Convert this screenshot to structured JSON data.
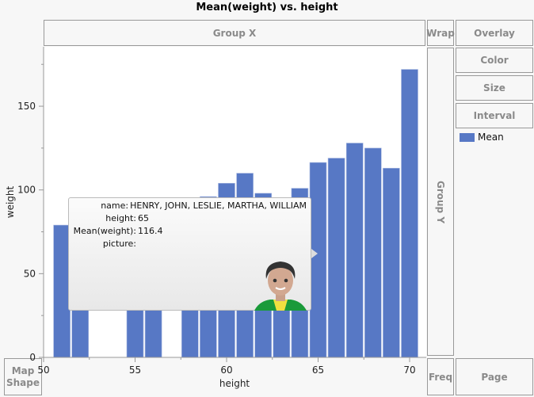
{
  "title": "Mean(weight) vs. height",
  "zones": {
    "group_x": "Group X",
    "group_y": "Group Y",
    "wrap": "Wrap",
    "overlay": "Overlay",
    "color": "Color",
    "size": "Size",
    "interval": "Interval",
    "freq": "Freq",
    "page": "Page",
    "map_shape": "Map Shape"
  },
  "legend": {
    "label": "Mean",
    "color": "#5778c5"
  },
  "tooltip": {
    "rows": [
      {
        "label": "name:",
        "value": "HENRY, JOHN, LESLIE, MARTHA, WILLIAM"
      },
      {
        "label": "height:",
        "value": "65"
      },
      {
        "label": "Mean(weight):",
        "value": "116.4"
      },
      {
        "label": "picture:",
        "value": ""
      }
    ]
  },
  "chart_data": {
    "type": "bar",
    "title": "Mean(weight) vs. height",
    "xlabel": "height",
    "ylabel": "weight",
    "xlim": [
      50,
      71
    ],
    "ylim": [
      0,
      180
    ],
    "xticks": [
      50,
      55,
      60,
      65,
      70
    ],
    "yticks": [
      0,
      50,
      100,
      150
    ],
    "series": [
      {
        "name": "Mean",
        "color": "#5778c5",
        "x": [
          51,
          52,
          55,
          56,
          58,
          59,
          60,
          61,
          62,
          63,
          64,
          65,
          66,
          67,
          68,
          69,
          70
        ],
        "values": [
          79,
          64,
          74,
          67,
          91,
          96,
          104,
          110,
          98,
          92,
          101,
          116.4,
          119,
          128,
          125,
          113,
          172
        ]
      }
    ]
  }
}
